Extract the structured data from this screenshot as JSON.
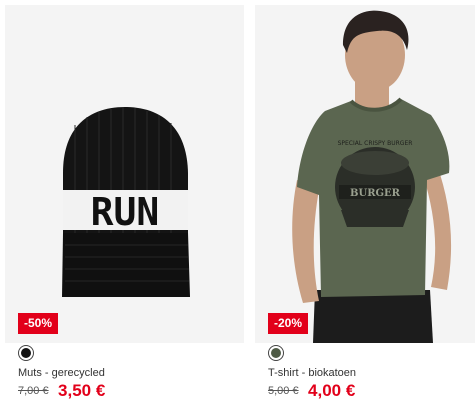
{
  "products": [
    {
      "badge": "-50%",
      "swatch_color": "#111111",
      "title": "Muts - gerecycled",
      "old_price": "7,00 €",
      "new_price": "3,50 €",
      "hat_text": "RUN"
    },
    {
      "badge": "-20%",
      "swatch_color": "#4e5a45",
      "title": "T-shirt - biokatoen",
      "old_price": "5,00 €",
      "new_price": "4,00 €",
      "shirt_print_top": "SPECIAL CRISPY BURGER",
      "shirt_print_main": "BURGER"
    }
  ],
  "colors": {
    "accent": "#e2001a",
    "shirt": "#5b6650"
  }
}
